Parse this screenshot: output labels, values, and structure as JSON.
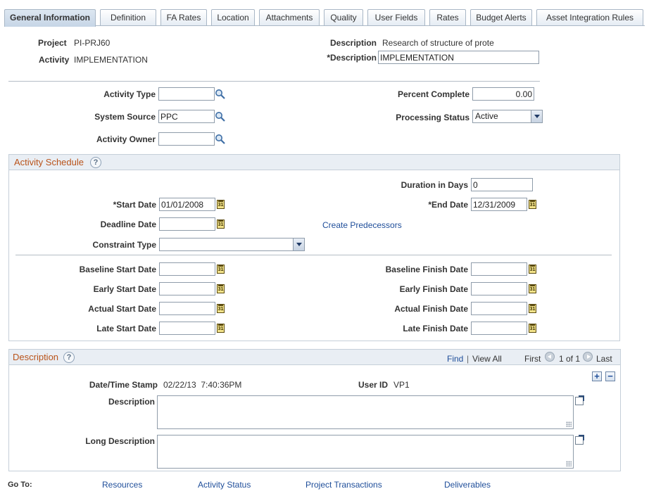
{
  "tabs": [
    {
      "label": "General Information",
      "active": true
    },
    {
      "label": "Definition"
    },
    {
      "label": "FA Rates"
    },
    {
      "label": "Location"
    },
    {
      "label": "Attachments"
    },
    {
      "label": "Quality"
    },
    {
      "label": "User Fields"
    },
    {
      "label": "Rates"
    },
    {
      "label": "Budget Alerts"
    },
    {
      "label": "Asset Integration Rules"
    }
  ],
  "header": {
    "project_label": "Project",
    "project_value": "PI-PRJ60",
    "activity_label": "Activity",
    "activity_value": "IMPLEMENTATION",
    "description_label": "Description",
    "description_value": "Research of structure of prote",
    "req_description_label": "*Description",
    "req_description_value": "IMPLEMENTATION"
  },
  "fields": {
    "activity_type_label": "Activity Type",
    "activity_type_value": "",
    "system_source_label": "System Source",
    "system_source_value": "PPC",
    "activity_owner_label": "Activity Owner",
    "activity_owner_value": "",
    "percent_complete_label": "Percent Complete",
    "percent_complete_value": "0.00",
    "processing_status_label": "Processing Status",
    "processing_status_value": "Active"
  },
  "schedule": {
    "title": "Activity Schedule",
    "duration_label": "Duration in Days",
    "duration_value": "0",
    "start_date_label": "*Start Date",
    "start_date_value": "01/01/2008",
    "end_date_label": "*End Date",
    "end_date_value": "12/31/2009",
    "deadline_label": "Deadline Date",
    "deadline_value": "",
    "create_predecessors": "Create Predecessors",
    "constraint_label": "Constraint Type",
    "constraint_value": "",
    "baseline_start_label": "Baseline Start Date",
    "baseline_finish_label": "Baseline Finish Date",
    "early_start_label": "Early Start Date",
    "early_finish_label": "Early Finish Date",
    "actual_start_label": "Actual Start Date",
    "actual_finish_label": "Actual Finish Date",
    "late_start_label": "Late Start Date",
    "late_finish_label": "Late Finish Date",
    "calendar_glyph": "31"
  },
  "description_group": {
    "title": "Description",
    "find": "Find",
    "separator": "|",
    "view_all": "View All",
    "first": "First",
    "page_info": "1 of 1",
    "last": "Last",
    "datetime_label": "Date/Time Stamp",
    "datetime_value": "02/22/13  7:40:36PM",
    "userid_label": "User ID",
    "userid_value": "VP1",
    "description_label": "Description",
    "long_description_label": "Long Description",
    "add_glyph": "+",
    "remove_glyph": "−"
  },
  "goto": {
    "label": "Go To:",
    "links": [
      "Resources",
      "Activity Status",
      "Project Transactions",
      "Deliverables"
    ]
  },
  "help_glyph": "?",
  "colors": {
    "group_title": "#b9531a",
    "link": "#1f4e9a",
    "tab_active": "#c6d5e6"
  }
}
